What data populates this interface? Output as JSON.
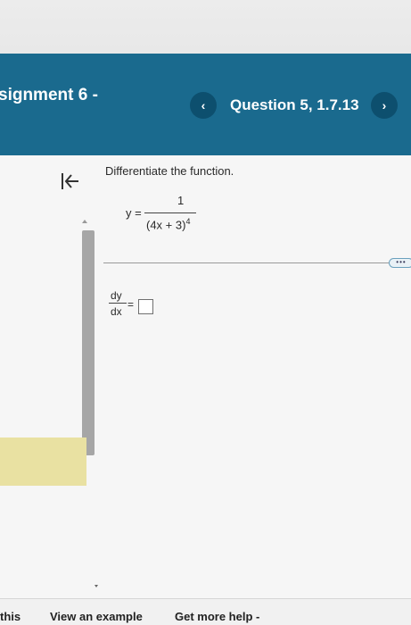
{
  "header": {
    "assignment_title": "signment 6 -",
    "question_label": "Question 5, 1.7.13",
    "prev_icon": "‹",
    "next_icon": "›"
  },
  "question": {
    "prompt": "Differentiate the function.",
    "function": {
      "lhs": "y =",
      "numerator": "1",
      "denominator_base": "(4x + 3)",
      "denominator_exponent": "4"
    },
    "answer": {
      "numerator": "dy",
      "denominator": "dx",
      "equals": "=",
      "value": ""
    },
    "more_label": "•••"
  },
  "footer": {
    "links": [
      "this",
      "View an example",
      "Get more help -"
    ]
  },
  "colors": {
    "header_bg": "#1a6a8e",
    "nav_circle_bg": "#0d4f6e",
    "highlight": "#e9e1a2"
  }
}
